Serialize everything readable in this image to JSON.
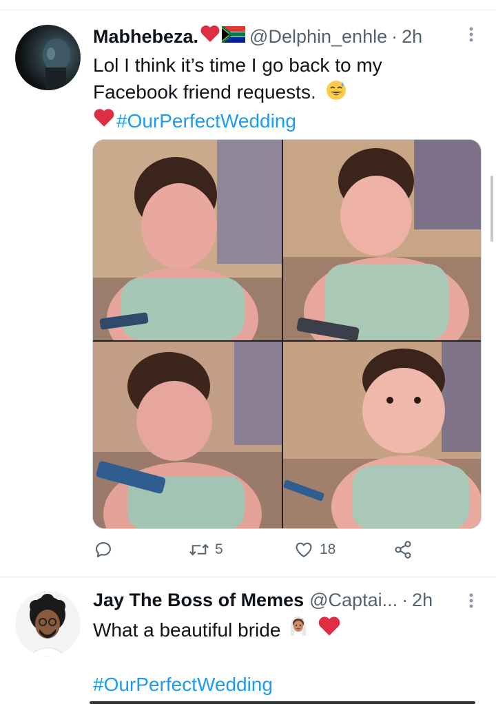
{
  "tweets": [
    {
      "display_name": "Mabhebeza.",
      "handle": "@Delphin_enhle",
      "dot": "·",
      "time": "2h",
      "text_line1": "Lol I think it’s time I go back to my",
      "text_line2": "Facebook friend requests.",
      "hashtag": "#OurPerfectWedding",
      "replies": "",
      "retweets": "5",
      "likes": "18"
    },
    {
      "display_name": "Jay The Boss of Memes",
      "handle": "@Captai...",
      "dot": "·",
      "time": "2h",
      "text": "What a beautiful bride",
      "hashtag": "#OurPerfectWedding"
    }
  ],
  "icons": {
    "more": "more-options-icon",
    "reply": "reply-icon",
    "retweet": "retweet-icon",
    "like": "heart-icon",
    "share": "share-icon"
  },
  "colors": {
    "link": "#1d9bf0",
    "muted": "#536471",
    "heart": "#e0245e"
  }
}
